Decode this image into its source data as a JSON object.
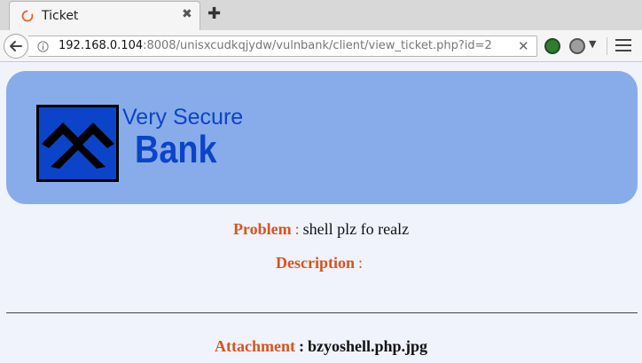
{
  "tab": {
    "title": "Ticket",
    "close_glyph": "✖",
    "new_tab_glyph": "✚",
    "favicon": "firefox-loading-icon"
  },
  "navbar": {
    "url_host": "192.168.0.104",
    "url_rest": ":8008/unisxcudkqjydw/vulnbank/client/view_ticket.php?id=2",
    "clear_glyph": "✕",
    "icons": [
      "back-arrow-icon",
      "info-icon",
      "extension-green-icon",
      "extension-gray-icon",
      "hamburger-menu-icon"
    ]
  },
  "logo": {
    "line1": "Very Secure",
    "line2": "Bank"
  },
  "ticket": {
    "problem_label": "Problem",
    "problem_value": "shell plz fo realz",
    "description_label": "Description",
    "description_value": "",
    "attachment_label": "Attachment",
    "attachment_value": "bzyoshell.php.jpg",
    "separator": ":"
  },
  "colors": {
    "banner": "#88acea",
    "label": "#d9531e",
    "logo": "#0b44c8",
    "page_bg": "#f0f3fc"
  }
}
